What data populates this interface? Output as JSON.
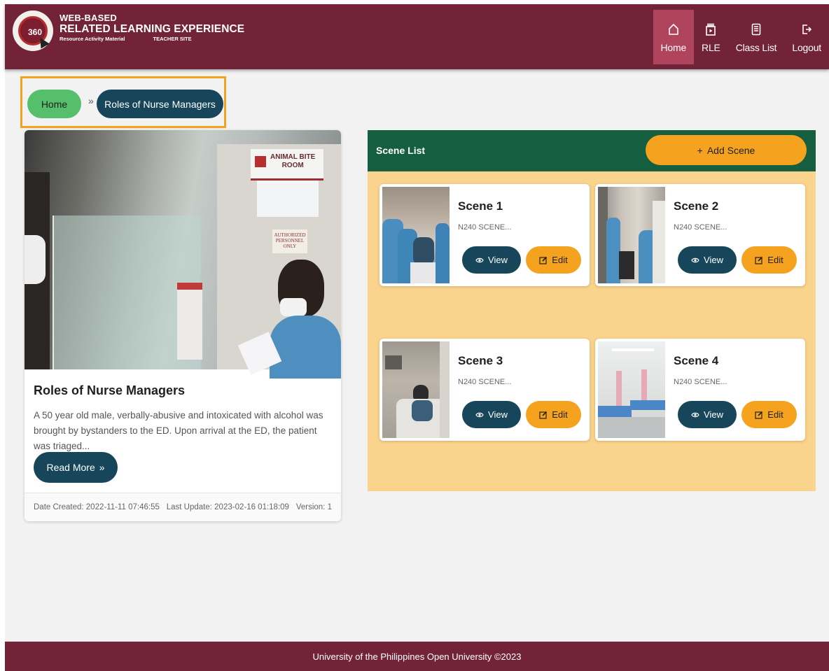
{
  "header": {
    "brand_line1": "WEB-BASED",
    "brand_line2": "RELATED LEARNING EXPERIENCE",
    "brand_line3a": "Resource Activity Material",
    "brand_line3b": "TEACHER SITE",
    "logo_text": "360",
    "nav": [
      {
        "label": "Home",
        "icon": "home-icon",
        "active": true
      },
      {
        "label": "RLE",
        "icon": "rle-icon",
        "active": false
      },
      {
        "label": "Class List",
        "icon": "class-list-icon",
        "active": false
      },
      {
        "label": "Logout",
        "icon": "logout-icon",
        "active": false
      }
    ]
  },
  "breadcrumb": {
    "home": "Home",
    "separator": "»",
    "current": "Roles of Nurse Managers"
  },
  "activity": {
    "image_sign_line1": "ANIMAL BITE",
    "image_sign_line2": "ROOM",
    "image_auth_text": "AUTHORIZED PERSONNEL ONLY",
    "title": "Roles of Nurse Managers",
    "description": "A 50 year old male, verbally-abusive and intoxicated with alcohol was brought by bystanders to the ED. Upon arrival at the ED, the patient was triaged...",
    "read_more": "Read More",
    "read_more_icon": "»",
    "date_created": "Date Created: 2022-11-11 07:46:55",
    "last_update": "Last Update: 2023-02-16 01:18:09",
    "version": "Version: 1"
  },
  "scene_list": {
    "title": "Scene List",
    "add_button": "Add Scene",
    "add_icon": "+",
    "view_label": "View",
    "edit_label": "Edit",
    "scenes": [
      {
        "name": "Scene 1",
        "subtitle": "N240 SCENE..."
      },
      {
        "name": "Scene 2",
        "subtitle": "N240 SCENE..."
      },
      {
        "name": "Scene 3",
        "subtitle": "N240 SCENE..."
      },
      {
        "name": "Scene 4",
        "subtitle": "N240 SCENE..."
      }
    ]
  },
  "footer": {
    "text": "University of the Philippines Open University ©2023"
  },
  "colors": {
    "header_bg": "#722338",
    "nav_active": "#b0445c",
    "primary_dark": "#17465b",
    "accent_orange": "#f5a31f",
    "home_green": "#55bf6b",
    "scene_header": "#155f40",
    "scene_panel": "#fad38c"
  }
}
